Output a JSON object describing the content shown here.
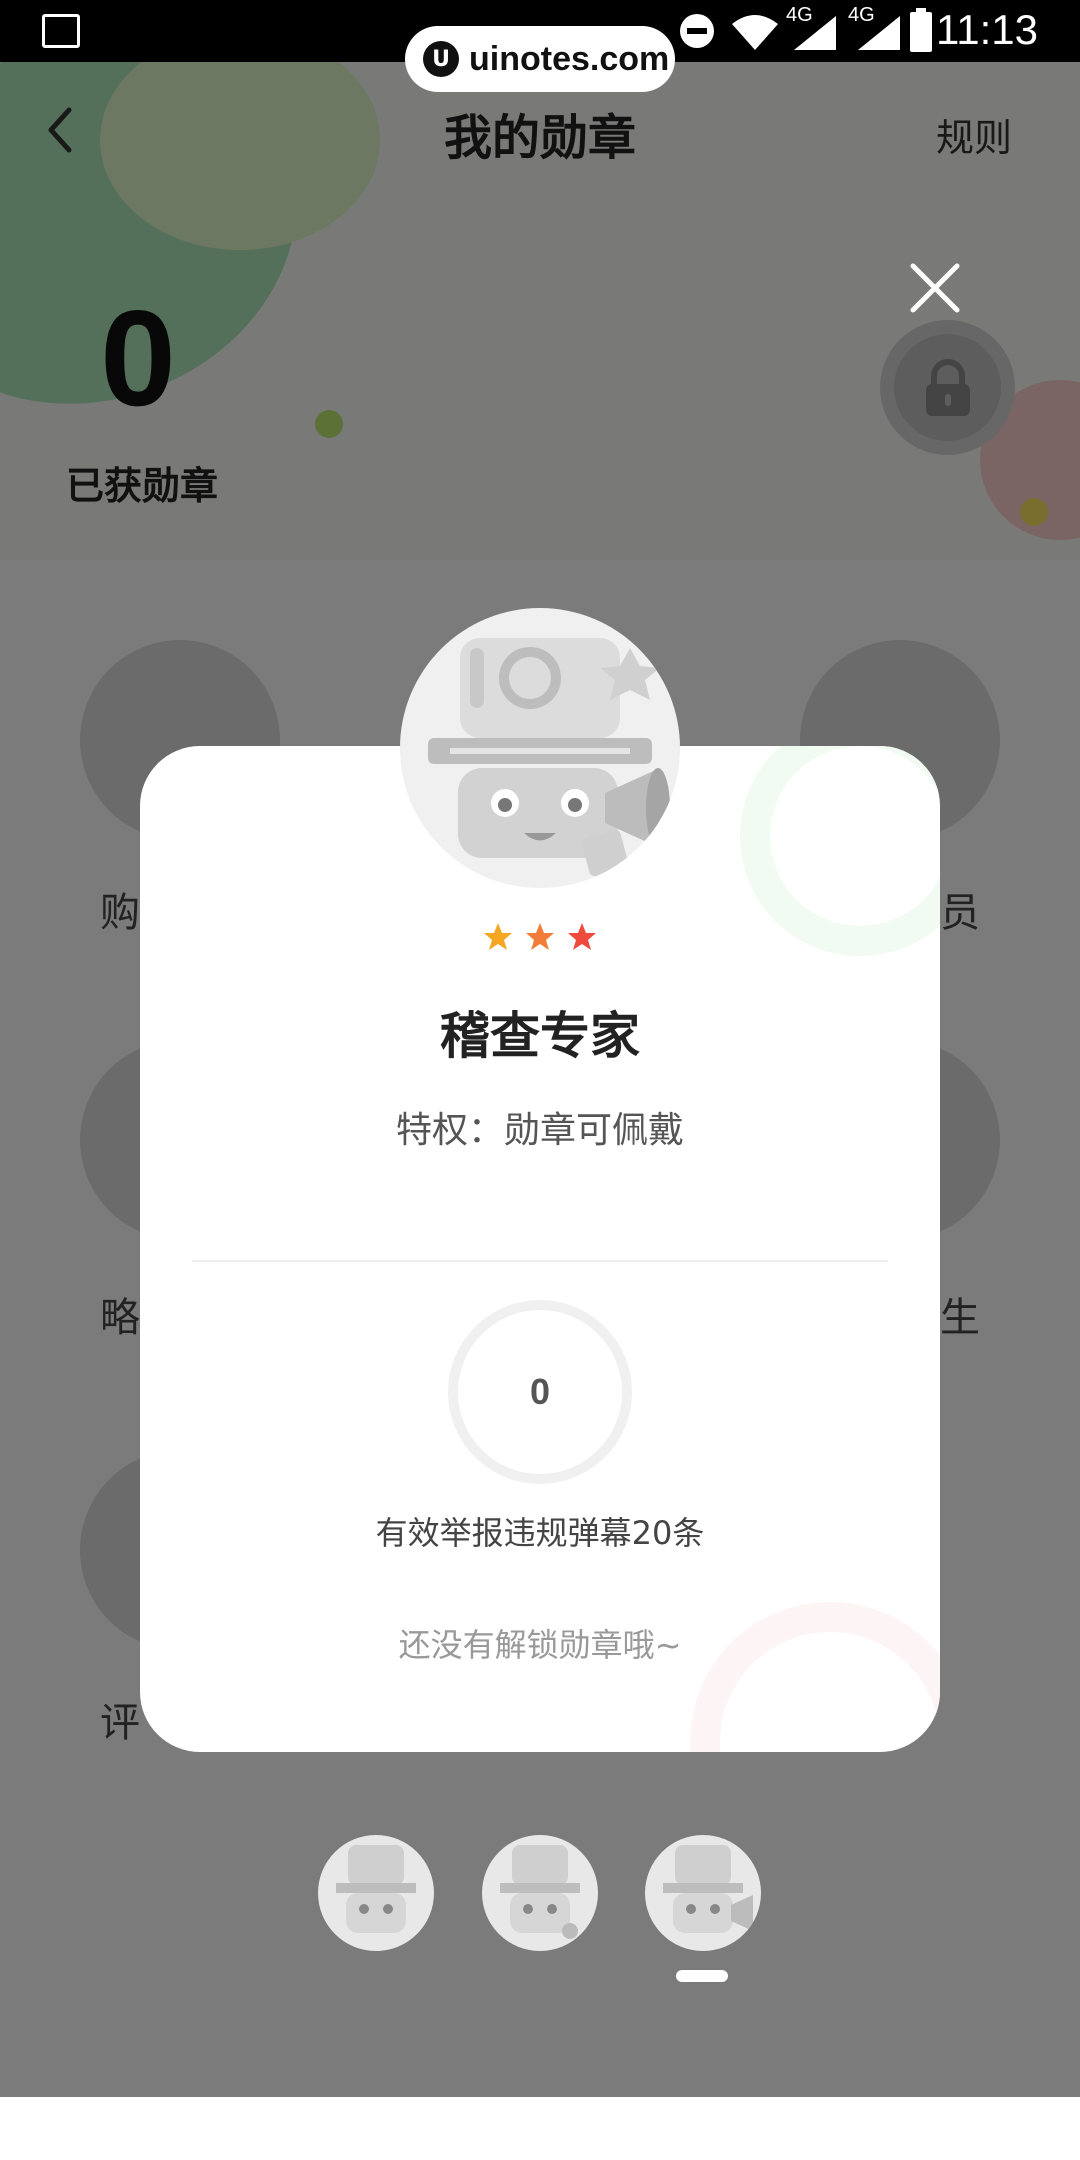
{
  "status_bar": {
    "time": "11:13",
    "network_1": "4G",
    "network_2": "4G",
    "icons": [
      "image-icon",
      "dnd-icon",
      "wifi-icon",
      "signal-icon",
      "signal-icon",
      "battery-icon"
    ]
  },
  "watermark": {
    "text": "uinotes.com"
  },
  "header": {
    "title": "我的勋章",
    "rules_label": "规则"
  },
  "summary": {
    "count": "0",
    "label": "已获勋章"
  },
  "background_badges": [
    {
      "label": "购"
    },
    {
      "label": "员"
    },
    {
      "label": "略"
    },
    {
      "label": "生"
    },
    {
      "label": "评"
    }
  ],
  "modal": {
    "stars": 3,
    "star_colors": [
      "#F5A623",
      "#F27D3A",
      "#EF4B3C"
    ],
    "title": "稽查专家",
    "privilege": "特权：勋章可佩戴",
    "progress_value": "0",
    "task": "有效举报违规弹幕20条",
    "hint": "还没有解锁勋章哦~"
  },
  "carousel": {
    "items": [
      "badge-thumb-1",
      "badge-thumb-2",
      "badge-thumb-3"
    ],
    "active_index": 2
  }
}
